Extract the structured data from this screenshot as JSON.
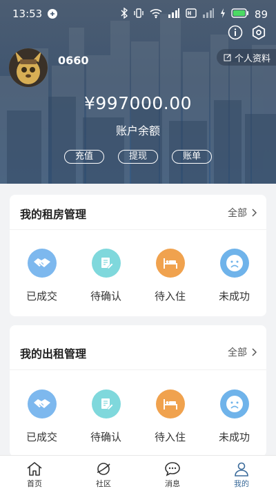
{
  "status_bar": {
    "time": "13:53",
    "battery": "89"
  },
  "profile": {
    "username": "0660",
    "profile_link": "个人资料",
    "balance": "¥997000.00",
    "balance_label": "账户余额",
    "actions": [
      "充值",
      "提现",
      "账单"
    ]
  },
  "rent_mgmt": {
    "title": "我的租房管理",
    "more": "全部",
    "items": [
      {
        "label": "已成交",
        "icon": "handshake-icon",
        "color": "#7db8ee"
      },
      {
        "label": "待确认",
        "icon": "document-edit-icon",
        "color": "#7fd8dc"
      },
      {
        "label": "待入住",
        "icon": "bed-icon",
        "color": "#f0a24e"
      },
      {
        "label": "未成功",
        "icon": "sad-face-icon",
        "color": "#6fb3ea"
      }
    ]
  },
  "lease_mgmt": {
    "title": "我的出租管理",
    "more": "全部",
    "items": [
      {
        "label": "已成交",
        "icon": "handshake-icon",
        "color": "#7db8ee"
      },
      {
        "label": "待确认",
        "icon": "document-edit-icon",
        "color": "#7fd8dc"
      },
      {
        "label": "待入住",
        "icon": "bed-icon",
        "color": "#f0a24e"
      },
      {
        "label": "未成功",
        "icon": "sad-face-icon",
        "color": "#6fb3ea"
      }
    ]
  },
  "tabbar": {
    "tabs": [
      {
        "label": "首页",
        "icon": "home-icon"
      },
      {
        "label": "社区",
        "icon": "planet-icon"
      },
      {
        "label": "消息",
        "icon": "chat-icon"
      },
      {
        "label": "我的",
        "icon": "user-icon",
        "active": true
      }
    ]
  },
  "colors": {
    "accent": "#3a6a9a",
    "header_bg": "#3f5570"
  }
}
